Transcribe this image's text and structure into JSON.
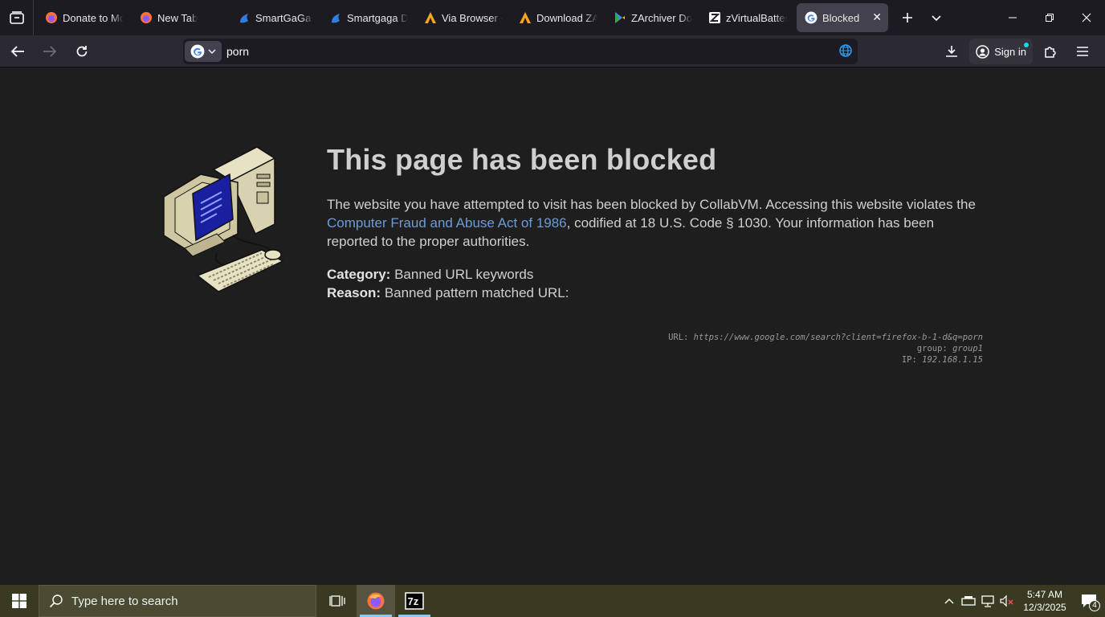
{
  "tabs": [
    {
      "label": "Donate to Mo",
      "icon": "firefox-icon"
    },
    {
      "label": "New Tab",
      "icon": "firefox-icon"
    },
    {
      "label": "SmartGaGa Do",
      "icon": "smartgaga-icon"
    },
    {
      "label": "Smartgaga Do",
      "icon": "smartgaga-icon"
    },
    {
      "label": "Via Browser - ",
      "icon": "via-icon"
    },
    {
      "label": "Download ZAr",
      "icon": "via-icon"
    },
    {
      "label": "ZArchiver Dov",
      "icon": "play-store-icon"
    },
    {
      "label": "zVirtualBattery",
      "icon": "zvirtual-icon"
    },
    {
      "label": "Blocked",
      "icon": "google-icon",
      "active": true
    }
  ],
  "navbar": {
    "url": "porn",
    "sign_in": "Sign in"
  },
  "page": {
    "headline": "This page has been blocked",
    "message_pre": "The website you have attempted to visit has been blocked by CollabVM. Accessing this website violates the ",
    "message_link": "Computer Fraud and Abuse Act of 1986",
    "message_post": ", codified at 18 U.S. Code § 1030. Your information has been reported to the proper authorities.",
    "category_label": "Category:",
    "category_value": "Banned URL keywords",
    "reason_label": "Reason:",
    "reason_value": "Banned pattern matched URL:",
    "url_label": "URL: ",
    "url_value": "https://www.google.com/search?client=firefox-b-1-d&q=porn",
    "group_label": "group: ",
    "group_value": "group1",
    "ip_label": "IP: ",
    "ip_value": "192.168.1.15"
  },
  "taskbar": {
    "search_placeholder": "Type here to search",
    "time": "5:47 AM",
    "date": "12/3/2025",
    "notification_count": "4"
  },
  "colors": {
    "accent_link": "#6f9ad8",
    "taskbar": "#3a3a22"
  }
}
